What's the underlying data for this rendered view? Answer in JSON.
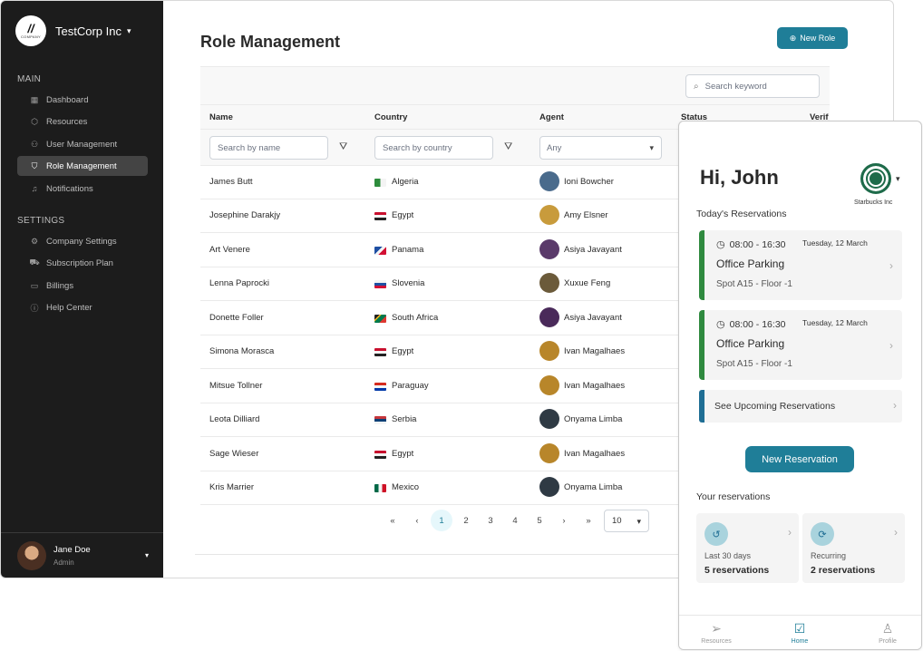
{
  "sidebar": {
    "company": "TestCorp Inc",
    "logo_mark": "//",
    "logo_text": "COMPANY",
    "sections": [
      {
        "title": "MAIN",
        "items": [
          {
            "label": "Dashboard",
            "icon": "grid-icon"
          },
          {
            "label": "Resources",
            "icon": "cube-icon"
          },
          {
            "label": "User Management",
            "icon": "users-icon"
          },
          {
            "label": "Role Management",
            "icon": "shield-icon",
            "active": true
          },
          {
            "label": "Notifications",
            "icon": "bell-icon"
          }
        ]
      },
      {
        "title": "SETTINGS",
        "items": [
          {
            "label": "Company Settings",
            "icon": "settings-icon"
          },
          {
            "label": "Subscription Plan",
            "icon": "cart-icon"
          },
          {
            "label": "Billings",
            "icon": "card-icon"
          },
          {
            "label": "Help Center",
            "icon": "help-icon"
          }
        ]
      }
    ],
    "user": {
      "name": "Jane Doe",
      "role": "Admin"
    }
  },
  "main": {
    "title": "Role Management",
    "new_role_label": "New Role",
    "search_placeholder": "Search keyword",
    "columns": [
      "Name",
      "Country",
      "Agent",
      "Status",
      "Verif"
    ],
    "filters": {
      "name_placeholder": "Search by name",
      "country_placeholder": "Search by country",
      "agent_value": "Any"
    },
    "rows": [
      {
        "name": "James Butt",
        "country": "Algeria",
        "agent": "Ioni Bowcher"
      },
      {
        "name": "Josephine Darakjy",
        "country": "Egypt",
        "agent": "Amy Elsner"
      },
      {
        "name": "Art Venere",
        "country": "Panama",
        "agent": "Asiya Javayant"
      },
      {
        "name": "Lenna Paprocki",
        "country": "Slovenia",
        "agent": "Xuxue Feng"
      },
      {
        "name": "Donette Foller",
        "country": "South Africa",
        "agent": "Asiya Javayant"
      },
      {
        "name": "Simona Morasca",
        "country": "Egypt",
        "agent": "Ivan Magalhaes"
      },
      {
        "name": "Mitsue Tollner",
        "country": "Paraguay",
        "agent": "Ivan Magalhaes"
      },
      {
        "name": "Leota Dilliard",
        "country": "Serbia",
        "agent": "Onyama Limba"
      },
      {
        "name": "Sage Wieser",
        "country": "Egypt",
        "agent": "Ivan Magalhaes"
      },
      {
        "name": "Kris Marrier",
        "country": "Mexico",
        "agent": "Onyama Limba"
      }
    ],
    "pager": {
      "first": "«",
      "prev": "‹",
      "pages": [
        "1",
        "2",
        "3",
        "4",
        "5"
      ],
      "next": "›",
      "last": "»",
      "current": "1",
      "page_size": "10"
    }
  },
  "mobile": {
    "greeting": "Hi, John",
    "company": "Starbucks Inc",
    "today_label": "Today's Reservations",
    "reservations": [
      {
        "time": "08:00 - 16:30",
        "date": "Tuesday, 12 March",
        "title": "Office Parking",
        "spot": "Spot A15 - Floor -1"
      },
      {
        "time": "08:00 - 16:30",
        "date": "Tuesday, 12 March",
        "title": "Office Parking",
        "spot": "Spot A15 - Floor -1"
      }
    ],
    "upcoming_label": "See Upcoming Reservations",
    "new_reservation_label": "New Reservation",
    "your_label": "Your reservations",
    "stats": [
      {
        "label": "Last 30 days",
        "value": "5 reservations",
        "icon": "history-icon"
      },
      {
        "label": "Recurring",
        "value": "2 reservations",
        "icon": "refresh-icon"
      }
    ],
    "tabs": [
      {
        "label": "Resources",
        "icon": "send-icon"
      },
      {
        "label": "Home",
        "icon": "calendar-check-icon",
        "active": true
      },
      {
        "label": "Profile",
        "icon": "user-icon"
      }
    ]
  },
  "colors": {
    "accent": "#1f7e98",
    "sidebar_bg": "#1c1c1c",
    "reservation_bar": "#2f8a3f",
    "upcoming_bar": "#1f6e94"
  }
}
